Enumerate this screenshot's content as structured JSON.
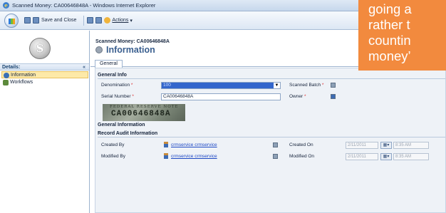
{
  "window": {
    "title": "Scanned Money: CA00646848A - Windows Internet Explorer"
  },
  "toolbar": {
    "save_close": "Save and Close",
    "actions": "Actions"
  },
  "nav": {
    "header": "Details:",
    "items": [
      {
        "label": "Information"
      },
      {
        "label": "Workflows"
      }
    ]
  },
  "record": {
    "type_label": "Scanned Money: CA00646848A",
    "title": "Information"
  },
  "tabs": [
    {
      "label": "General"
    }
  ],
  "form": {
    "section_general": "General Info",
    "denomination_label": "Denomination",
    "denomination_value": "100",
    "scanned_batch_label": "Scanned Batch",
    "serial_label": "Serial Number",
    "serial_value": "CA00646848A",
    "owner_label": "Owner",
    "bill_text_top": "FEDERAL RESERVE NOTE",
    "bill_text_serial": "CA00646848A",
    "section_general_information": "General Information",
    "section_audit": "Record Audit Information",
    "created_by_label": "Created By",
    "created_by_value": "crmservice crmservice",
    "created_on_label": "Created On",
    "created_on_date": "2/11/2011",
    "created_on_time": "8:35 AM",
    "modified_by_label": "Modified By",
    "modified_by_value": "crmservice crmservice",
    "modified_on_label": "Modified On",
    "modified_on_date": "2/11/2011",
    "modified_on_time": "8:35 AM"
  },
  "callout": {
    "line1": "going a",
    "line2": "rather t",
    "line3": "countin",
    "line4": "money’"
  },
  "colors": {
    "accent": "#3a5f8f",
    "callout": "#f28a3e",
    "selection": "#3366cc"
  }
}
